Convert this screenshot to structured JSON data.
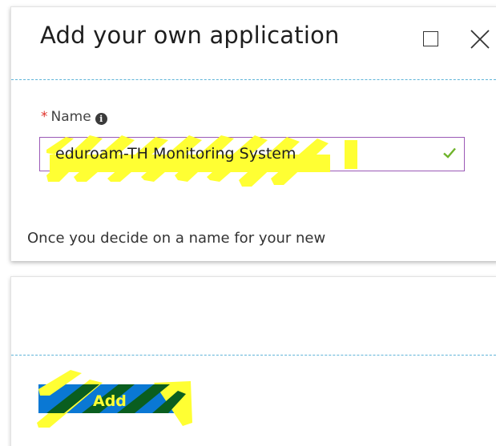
{
  "dialog": {
    "title": "Add your own application",
    "controls": {
      "maximize_icon": "maximize-icon",
      "close_icon": "close-icon"
    }
  },
  "name_field": {
    "required_marker": "*",
    "label": "Name",
    "info_icon_glyph": "i",
    "value": "eduroam-TH Monitoring System",
    "valid": true
  },
  "help_text": "Once you decide on a name for your new",
  "footer": {
    "add_label": "Add"
  },
  "colors": {
    "accent_separator": "#5fb4d8",
    "input_border": "#9b59b6",
    "valid_check": "#6fb32b",
    "required": "#e0322a",
    "button": "#0a78d4",
    "redaction_highlight": "#ffff33",
    "redaction_dark": "#0a5e1f"
  }
}
